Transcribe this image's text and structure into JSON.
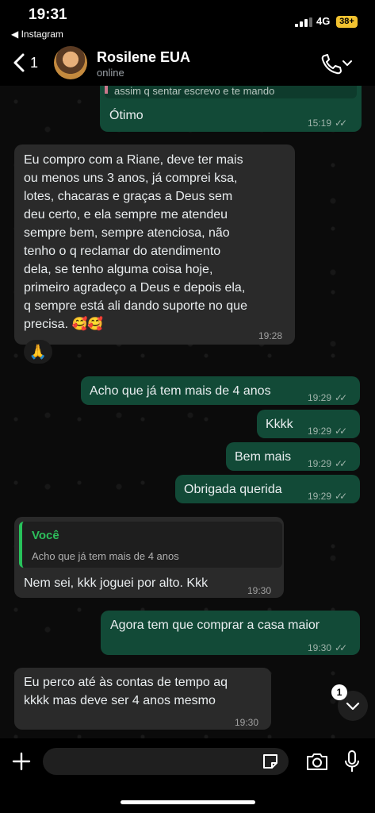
{
  "status_bar": {
    "time": "19:31",
    "back_app": "◀ Instagram",
    "network": "4G",
    "battery": "38+"
  },
  "header": {
    "unread_count": "1",
    "contact_name": "Rosilene EUA",
    "contact_status": "online"
  },
  "messages": [
    {
      "type": "out",
      "quoted_preview": "assim q sentar escrevo e te mando",
      "text": "Ótimo",
      "time": "15:19"
    },
    {
      "type": "in",
      "text_lines": [
        "Eu compro com a Riane, deve ter mais",
        "ou menos uns 3 anos, já comprei ksa,",
        "lotes, chacaras e graças a Deus sem",
        "deu certo, e ela sempre me atendeu",
        "sempre bem, sempre atenciosa, não",
        "tenho o q reclamar do atendimento",
        "dela, se tenho alguma coisa hoje,",
        "primeiro agradeço a Deus e depois ela,",
        "q sempre está ali dando suporte no que",
        "precisa. 🥰🥰"
      ],
      "time": "19:28",
      "reaction": "🙏"
    },
    {
      "type": "out",
      "text": "Acho que já tem mais de 4 anos",
      "time": "19:29"
    },
    {
      "type": "out",
      "text": "Kkkk",
      "time": "19:29"
    },
    {
      "type": "out",
      "text": "Bem mais",
      "time": "19:29"
    },
    {
      "type": "out",
      "text": "Obrigada querida",
      "time": "19:29"
    },
    {
      "type": "in",
      "quote_author": "Você",
      "quote_text": "Acho que já tem mais de 4 anos",
      "text": "Nem sei, kkk joguei por alto. Kkk",
      "time": "19:30"
    },
    {
      "type": "out",
      "text": "Agora tem que comprar a casa maior",
      "time": "19:30"
    },
    {
      "type": "in",
      "text_lines": [
        "Eu perco até às contas de tempo aq",
        "kkkk mas deve ser 4 anos mesmo"
      ],
      "time": "19:30"
    }
  ],
  "scroll_badge": "1",
  "colors": {
    "outgoing_bubble": "#124a37",
    "incoming_bubble": "#2a2a2a",
    "quote_accent": "#27c25b"
  },
  "icons": [
    "back-chevron-icon",
    "phone-icon",
    "chevron-down-icon",
    "plus-icon",
    "sticker-icon",
    "camera-icon",
    "mic-icon"
  ]
}
